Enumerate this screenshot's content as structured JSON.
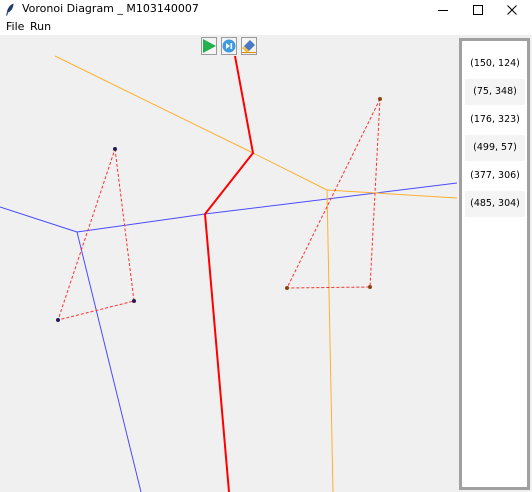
{
  "window": {
    "title": "Voronoi Diagram _ M103140007",
    "minimize_glyph": "–"
  },
  "menu": {
    "file_label": "File",
    "run_label": "Run"
  },
  "toolbar": {
    "run_icon": "play-icon",
    "step_icon": "step-icon",
    "clear_icon": "eraser-icon",
    "run_color": "#22b14c",
    "step_color": "#3e9be0"
  },
  "points_list": {
    "items": [
      "(150, 124)",
      "(75, 348)",
      "(176, 323)",
      "(499, 57)",
      "(377, 306)",
      "(485, 304)"
    ]
  },
  "colors": {
    "canvas_bg": "#f0f0f0",
    "left_voronoi": "#4a4aff",
    "right_voronoi": "#ffb030",
    "hyperplane": "#ff0000",
    "delaunay": "#ff3030",
    "left_sites": "#2a1a55",
    "right_sites": "#8b4513"
  }
}
